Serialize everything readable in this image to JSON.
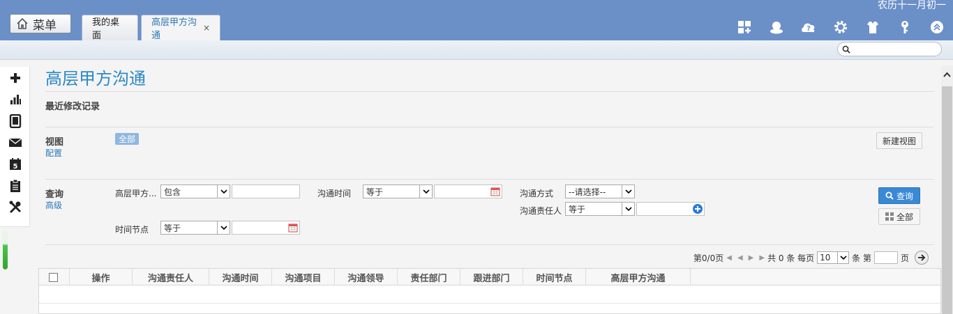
{
  "header": {
    "menu_label": "菜单",
    "lunar_date": "农历十一月初一",
    "tabs": [
      {
        "label": "我的桌面"
      },
      {
        "label": "高层甲方沟通",
        "active": true,
        "close": "×"
      }
    ],
    "tool_icons": [
      "apps-add-icon",
      "user-icon",
      "help-cloud-icon",
      "gear-icon",
      "shirt-icon",
      "key-icon",
      "collapse-up-icon"
    ],
    "search_placeholder": ""
  },
  "sidebar": {
    "icons": [
      "plus-icon",
      "bar-chart-icon",
      "tablet-icon",
      "mail-icon",
      "calendar-icon",
      "clipboard-icon",
      "tools-icon"
    ],
    "calendar_day": "5"
  },
  "page": {
    "title": "高层甲方沟通",
    "recent_label": "最近修改记录",
    "view": {
      "label": "视图",
      "config_link": "配置",
      "all_chip": "全部",
      "new_view_button": "新建视图"
    },
    "query": {
      "label": "查询",
      "advanced_link": "高级",
      "fields": {
        "f1_label": "高层甲方...",
        "f1_op": "包含",
        "f2_label": "沟通时间",
        "f2_op": "等于",
        "f3_label": "沟通方式",
        "f3_op": "--请选择--",
        "f4_label": "沟通责任人",
        "f4_op": "等于",
        "f5_label": "时间节点",
        "f5_op": "等于"
      },
      "search_button": "查询",
      "all_button": "全部"
    },
    "pager": {
      "page_text": "第0/0页",
      "total_text": "共 0 条 每页",
      "page_size": "10",
      "unit_text": "条 第",
      "page_suffix": "页"
    },
    "grid": {
      "columns": [
        "操作",
        "沟通责任人",
        "沟通时间",
        "沟通项目",
        "沟通领导",
        "责任部门",
        "跟进部门",
        "时间节点",
        "高层甲方沟通"
      ]
    }
  },
  "colors": {
    "header_bg": "#6b90c8",
    "title_blue": "#2b88c8",
    "link_blue": "#2b78b8",
    "query_button": "#3a89d6",
    "chip_bg": "#8fb7df"
  }
}
